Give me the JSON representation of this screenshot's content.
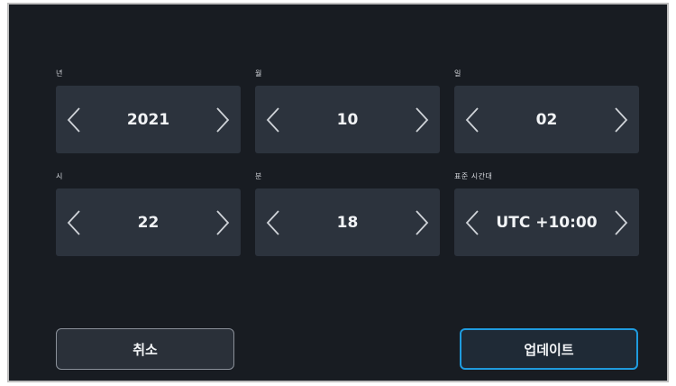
{
  "fields": [
    {
      "label": "년",
      "value": "2021"
    },
    {
      "label": "월",
      "value": "10"
    },
    {
      "label": "일",
      "value": "02"
    },
    {
      "label": "시",
      "value": "22"
    },
    {
      "label": "분",
      "value": "18"
    },
    {
      "label": "표준 시간대",
      "value": "UTC +10:00"
    }
  ],
  "icons": {
    "decrement": "chevron-left-icon",
    "increment": "chevron-right-icon"
  },
  "buttons": {
    "cancel_label": "취소",
    "update_label": "업데이트"
  },
  "colors": {
    "background": "#181c22",
    "stepper": "#2c333d",
    "accent": "#1f9bde",
    "text": "#f2f4f6"
  }
}
